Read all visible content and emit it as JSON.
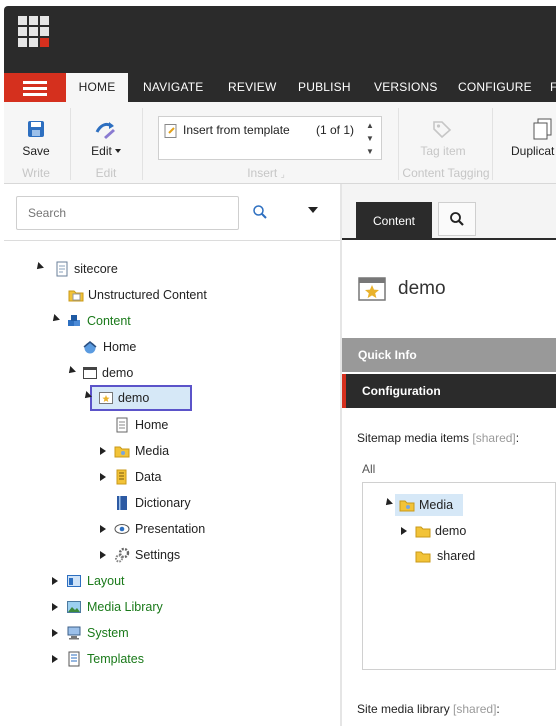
{
  "ribbon": {
    "tabs": [
      "HOME",
      "NAVIGATE",
      "REVIEW",
      "PUBLISH",
      "VERSIONS",
      "CONFIGURE",
      "F"
    ],
    "active_tab": "HOME",
    "save_label": "Save",
    "edit_label": "Edit",
    "write_group": "Write",
    "edit_group": "Edit",
    "insert_item": "Insert from template",
    "insert_count": "(1 of 1)",
    "insert_group": "Insert",
    "tag_item": "Tag item",
    "tagging_group": "Content Tagging",
    "duplicate_label": "Duplicat"
  },
  "search": {
    "placeholder": "Search"
  },
  "tree": {
    "sitecore": "sitecore",
    "unstructured": "Unstructured Content",
    "content": "Content",
    "home": "Home",
    "demo_site": "demo",
    "demo_selected": "demo",
    "demo_home": "Home",
    "media": "Media",
    "data": "Data",
    "dictionary": "Dictionary",
    "presentation": "Presentation",
    "settings": "Settings",
    "layout": "Layout",
    "media_library": "Media Library",
    "system": "System",
    "templates": "Templates"
  },
  "editor": {
    "content_tab": "Content",
    "item_title": "demo",
    "quick_info": "Quick Info",
    "configuration": "Configuration",
    "sitemap_label": "Sitemap media items",
    "shared_tag": "[shared]",
    "colon": ":",
    "all_label": "All",
    "media_tree": {
      "media": "Media",
      "demo": "demo",
      "shared": "shared"
    },
    "site_media_label": "Site media library",
    "shared_tag2": "[shared]",
    "colon2": ":"
  },
  "colors": {
    "accent_red": "#d5301e",
    "dark_bar": "#2b2b2b",
    "selection_border": "#5b53c9",
    "selection_fill": "#d6e8f7",
    "tree_green": "#1a7a1a"
  }
}
